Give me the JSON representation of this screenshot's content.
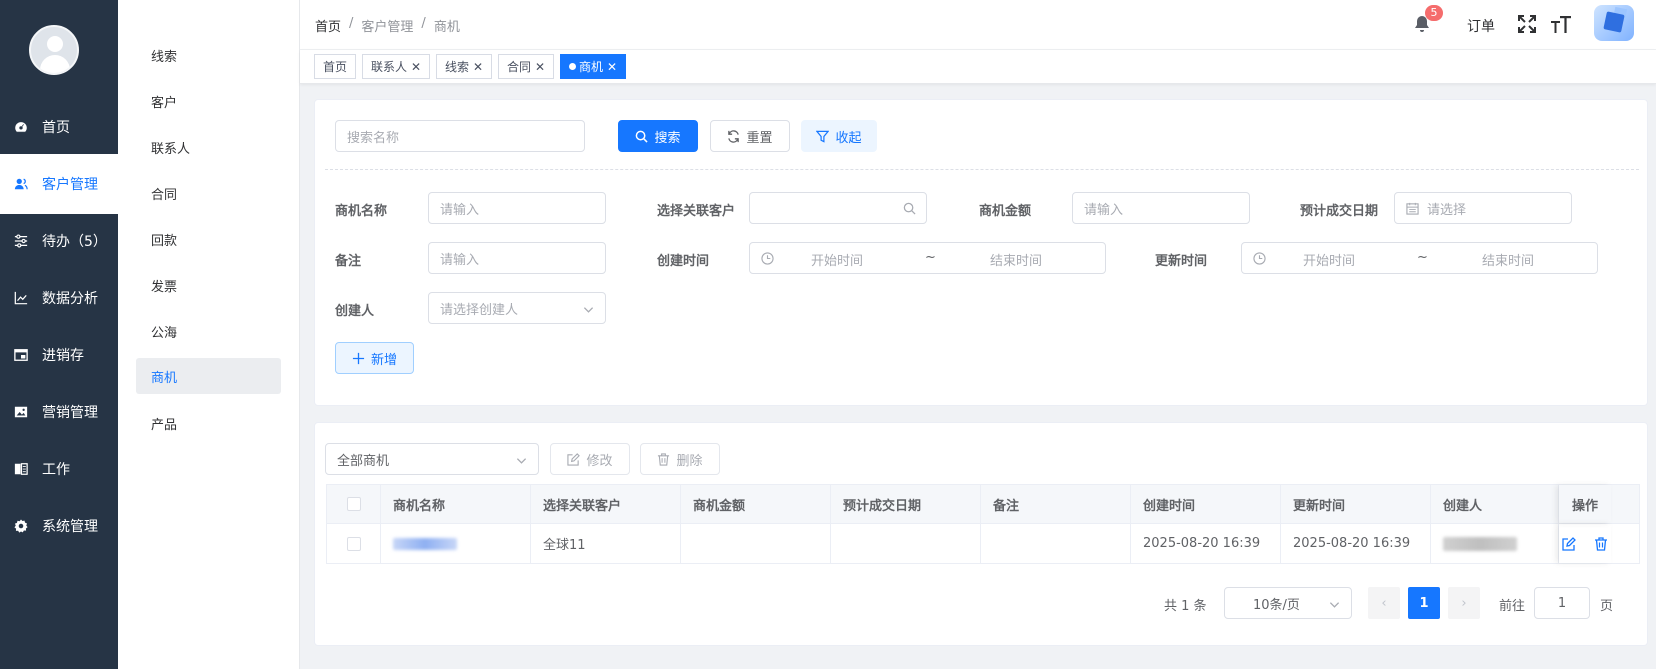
{
  "sidebar": {
    "items": [
      {
        "label": "首页",
        "icon": "dashboard-icon"
      },
      {
        "label": "客户管理",
        "icon": "user-icon"
      },
      {
        "label": "待办（5）",
        "icon": "sliders-icon"
      },
      {
        "label": "数据分析",
        "icon": "chart-icon"
      },
      {
        "label": "进销存",
        "icon": "window-icon"
      },
      {
        "label": "营销管理",
        "icon": "picture-icon"
      },
      {
        "label": "工作",
        "icon": "notebook-icon"
      },
      {
        "label": "系统管理",
        "icon": "gear-icon"
      }
    ],
    "active_index": 1
  },
  "submenu": {
    "items": [
      "线索",
      "客户",
      "联系人",
      "合同",
      "回款",
      "发票",
      "公海",
      "商机",
      "产品"
    ],
    "active_index": 7
  },
  "header": {
    "breadcrumb": [
      "首页",
      "客户管理",
      "商机"
    ],
    "notification_count": "5",
    "order_label": "订单"
  },
  "tags": [
    {
      "label": "首页",
      "closable": false
    },
    {
      "label": "联系人",
      "closable": true
    },
    {
      "label": "线索",
      "closable": true
    },
    {
      "label": "合同",
      "closable": true
    },
    {
      "label": "商机",
      "closable": true,
      "active": true
    }
  ],
  "search": {
    "placeholder": "搜索名称",
    "search_btn": "搜索",
    "reset_btn": "重置",
    "collapse_btn": "收起"
  },
  "filters": {
    "name_label": "商机名称",
    "name_placeholder": "请输入",
    "customer_label": "选择关联客户",
    "amount_label": "商机金额",
    "amount_placeholder": "请输入",
    "deal_date_label": "预计成交日期",
    "deal_date_placeholder": "请选择",
    "remark_label": "备注",
    "remark_placeholder": "请输入",
    "created_label": "创建时间",
    "updated_label": "更新时间",
    "range_start": "开始时间",
    "range_sep": "~",
    "range_end": "结束时间",
    "creator_label": "创建人",
    "creator_placeholder": "请选择创建人",
    "add_btn": "新增"
  },
  "table_toolbar": {
    "scope_select": "全部商机",
    "edit_btn": "修改",
    "delete_btn": "删除"
  },
  "table": {
    "columns": [
      "商机名称",
      "选择关联客户",
      "商机金额",
      "预计成交日期",
      "备注",
      "创建时间",
      "更新时间",
      "创建人",
      "操作"
    ],
    "rows": [
      {
        "customer": "全球11",
        "amount": "",
        "deal_date": "",
        "remark": "",
        "created": "2025-08-20 16:39",
        "updated": "2025-08-20 16:39"
      }
    ]
  },
  "pagination": {
    "total_text": "共 1 条",
    "page_size": "10条/页",
    "current_page": "1",
    "goto_label": "前往",
    "goto_value": "1",
    "page_suffix": "页"
  },
  "colors": {
    "primary": "#1677ff",
    "sidebar_bg": "#263445",
    "badge": "#f56c6c"
  }
}
